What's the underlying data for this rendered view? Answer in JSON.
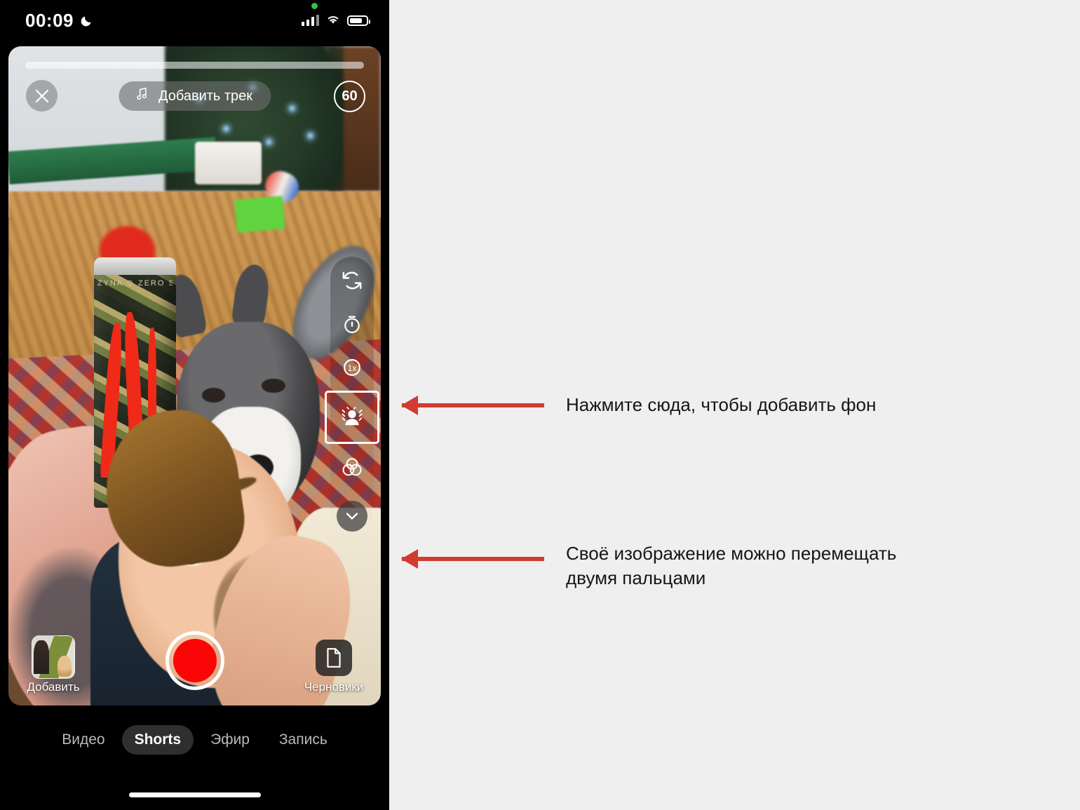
{
  "background_color": "#efefef",
  "accent_color": "#d23b32",
  "record_color": "#fa0606",
  "phone": {
    "status_bar": {
      "time": "00:09",
      "moon_icon": "moon-icon",
      "camera_in_use_dot": "green-dot-icon",
      "cellular_icon": "cellular-signal-icon",
      "wifi_icon": "wifi-icon",
      "battery_icon": "battery-icon"
    },
    "camera": {
      "progress_bar": "recording-progress-bar",
      "close_label": "✕",
      "close_icon": "close-icon",
      "music_icon": "music-note-icon",
      "add_track_label": "Добавить трек",
      "duration_label": "60",
      "side_tools": [
        {
          "name": "flip-camera",
          "icon": "flip-camera-icon",
          "label": ""
        },
        {
          "name": "timer",
          "icon": "timer-icon",
          "label": ""
        },
        {
          "name": "speed",
          "icon": "speed-icon",
          "label": "1x"
        },
        {
          "name": "green-screen",
          "icon": "green-screen-icon",
          "label": "",
          "highlighted": true
        },
        {
          "name": "filters",
          "icon": "filters-icon",
          "label": ""
        },
        {
          "name": "collapse",
          "icon": "chevron-down-icon",
          "label": ""
        }
      ],
      "add_label": "Добавить",
      "drafts_label": "Черновики",
      "drafts_icon": "document-icon",
      "record_button": "record-button"
    },
    "modes": [
      {
        "label": "Видео",
        "active": false
      },
      {
        "label": "Shorts",
        "active": true
      },
      {
        "label": "Эфир",
        "active": false
      },
      {
        "label": "Запись",
        "active": false
      }
    ],
    "home_indicator": "home-indicator"
  },
  "annotations": [
    {
      "id": "annot1",
      "text": "Нажмите сюда, чтобы добавить фон",
      "arrow": "left-arrow",
      "color": "#d23b32"
    },
    {
      "id": "annot2",
      "text": "Своё изображение можно перемещать\nдвумя пальцами",
      "arrow": "left-arrow",
      "color": "#d23b32"
    }
  ]
}
